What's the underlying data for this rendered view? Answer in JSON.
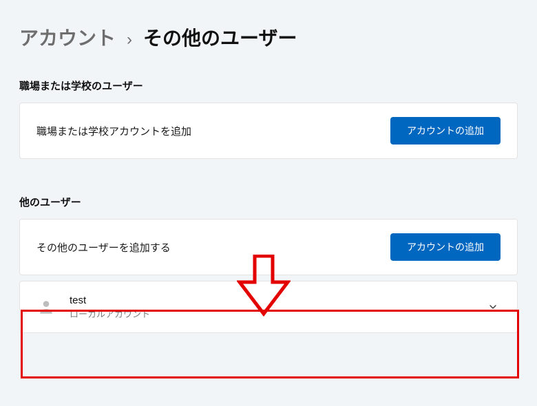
{
  "breadcrumb": {
    "parent": "アカウント",
    "current": "その他のユーザー"
  },
  "sections": {
    "work_school": {
      "label": "職場または学校のユーザー",
      "row_text": "職場または学校アカウントを追加",
      "button": "アカウントの追加"
    },
    "other": {
      "label": "他のユーザー",
      "row_text": "その他のユーザーを追加する",
      "button": "アカウントの追加"
    }
  },
  "user": {
    "name": "test",
    "subtitle": "ローカルアカウント"
  }
}
